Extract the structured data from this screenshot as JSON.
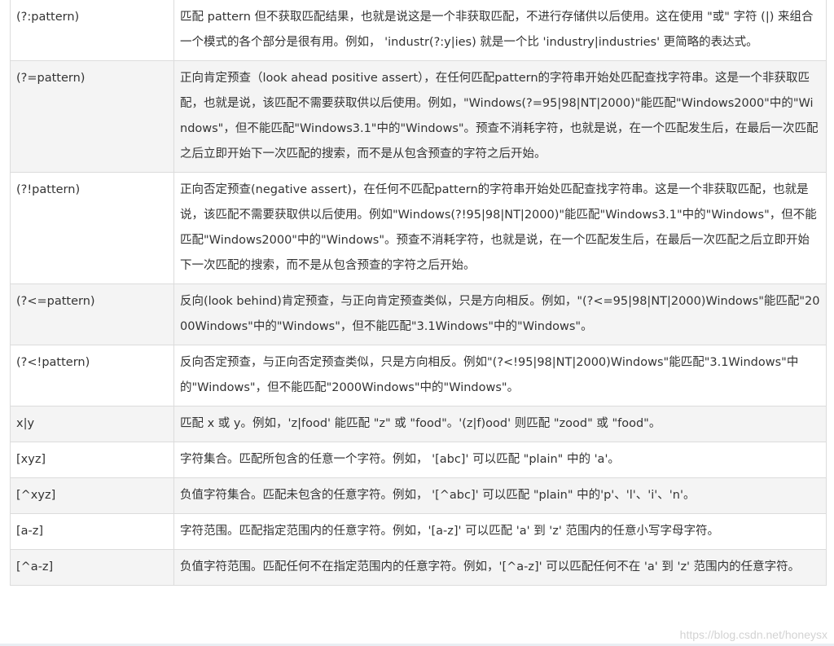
{
  "rows": [
    {
      "pattern": "(?:pattern)",
      "description": "匹配 pattern 但不获取匹配结果，也就是说这是一个非获取匹配，不进行存储供以后使用。这在使用 \"或\" 字符 (|) 来组合一个模式的各个部分是很有用。例如， 'industr(?:y|ies) 就是一个比 'industry|industries' 更简略的表达式。"
    },
    {
      "pattern": "(?=pattern)",
      "description": "正向肯定预查（look ahead positive assert），在任何匹配pattern的字符串开始处匹配查找字符串。这是一个非获取匹配，也就是说，该匹配不需要获取供以后使用。例如，\"Windows(?=95|98|NT|2000)\"能匹配\"Windows2000\"中的\"Windows\"，但不能匹配\"Windows3.1\"中的\"Windows\"。预查不消耗字符，也就是说，在一个匹配发生后，在最后一次匹配之后立即开始下一次匹配的搜索，而不是从包含预查的字符之后开始。"
    },
    {
      "pattern": "(?!pattern)",
      "description": "正向否定预查(negative assert)，在任何不匹配pattern的字符串开始处匹配查找字符串。这是一个非获取匹配，也就是说，该匹配不需要获取供以后使用。例如\"Windows(?!95|98|NT|2000)\"能匹配\"Windows3.1\"中的\"Windows\"，但不能匹配\"Windows2000\"中的\"Windows\"。预查不消耗字符，也就是说，在一个匹配发生后，在最后一次匹配之后立即开始下一次匹配的搜索，而不是从包含预查的字符之后开始。"
    },
    {
      "pattern": "(?<=pattern)",
      "description": "反向(look behind)肯定预查，与正向肯定预查类似，只是方向相反。例如，\"(?<=95|98|NT|2000)Windows\"能匹配\"2000Windows\"中的\"Windows\"，但不能匹配\"3.1Windows\"中的\"Windows\"。"
    },
    {
      "pattern": "(?<!pattern)",
      "description": "反向否定预查，与正向否定预查类似，只是方向相反。例如\"(?<!95|98|NT|2000)Windows\"能匹配\"3.1Windows\"中的\"Windows\"，但不能匹配\"2000Windows\"中的\"Windows\"。"
    },
    {
      "pattern": "x|y",
      "description": "匹配 x 或 y。例如，'z|food' 能匹配 \"z\" 或 \"food\"。'(z|f)ood' 则匹配 \"zood\" 或 \"food\"。"
    },
    {
      "pattern": "[xyz]",
      "description": "字符集合。匹配所包含的任意一个字符。例如， '[abc]' 可以匹配 \"plain\" 中的 'a'。"
    },
    {
      "pattern": "[^xyz]",
      "description": "负值字符集合。匹配未包含的任意字符。例如， '[^abc]' 可以匹配 \"plain\" 中的'p'、'l'、'i'、'n'。"
    },
    {
      "pattern": "[a-z]",
      "description": "字符范围。匹配指定范围内的任意字符。例如，'[a-z]' 可以匹配 'a' 到 'z' 范围内的任意小写字母字符。"
    },
    {
      "pattern": "[^a-z]",
      "description": "负值字符范围。匹配任何不在指定范围内的任意字符。例如，'[^a-z]' 可以匹配任何不在 'a' 到 'z' 范围内的任意字符。"
    }
  ],
  "watermark": "https://blog.csdn.net/honeysx"
}
